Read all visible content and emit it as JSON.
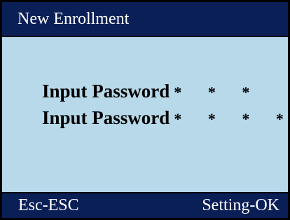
{
  "window": {
    "title": "New Enrollment"
  },
  "form": {
    "fields": [
      {
        "label": "Input Password",
        "masked_value": "* * *"
      },
      {
        "label": "Input Password",
        "masked_value": "* * * *"
      }
    ]
  },
  "footer": {
    "left_label": "Esc-ESC",
    "right_label": "Setting-OK"
  },
  "colors": {
    "titlebar_bg": "#0b1f57",
    "content_bg": "#b7d9e9",
    "text_light": "#ffffff",
    "text_dark": "#000000"
  }
}
